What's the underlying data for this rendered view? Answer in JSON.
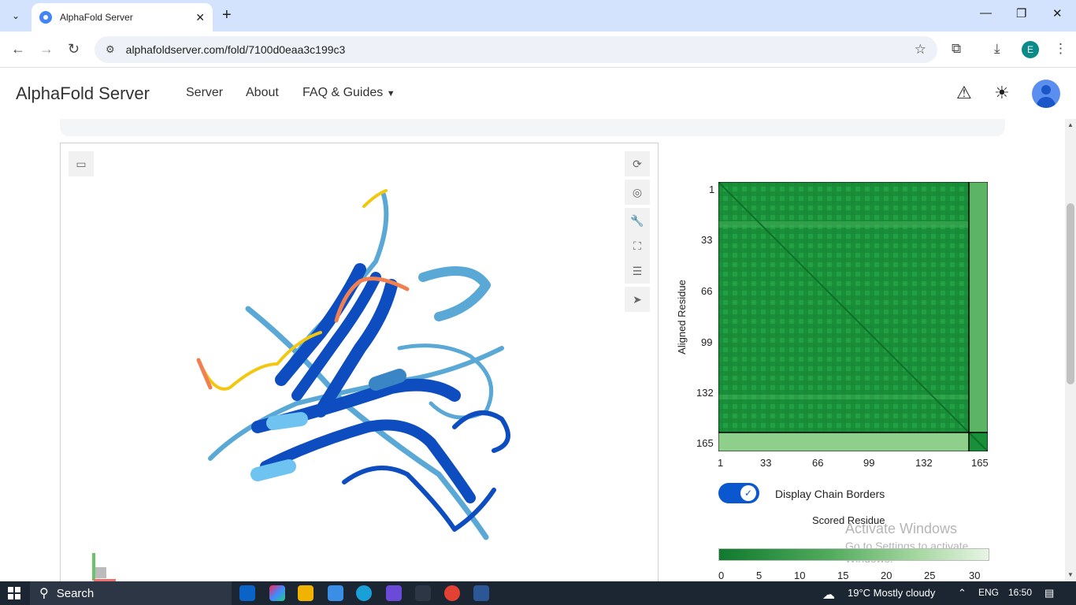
{
  "browser": {
    "tab_title": "AlphaFold Server",
    "url": "alphafoldserver.com/fold/7100d0eaa3c199c3",
    "profile_initial": "E"
  },
  "app": {
    "brand": "AlphaFold Server",
    "nav": [
      "Server",
      "About",
      "FAQ & Guides"
    ]
  },
  "pae": {
    "ylabel": "Aligned Residue",
    "xlabel": "Scored Residue",
    "y_ticks": [
      "1",
      "33",
      "66",
      "99",
      "132",
      "165"
    ],
    "x_ticks": [
      "1",
      "33",
      "66",
      "99",
      "132",
      "165"
    ],
    "toggle_label": "Display Chain Borders",
    "toggle_on": true,
    "colorbar_ticks": [
      "0",
      "5",
      "10",
      "15",
      "20",
      "25",
      "30"
    ],
    "colors": {
      "low": "#0f7a2e",
      "high": "#e8f5e4"
    }
  },
  "watermark": {
    "line1": "Activate Windows",
    "line2": "Go to Settings to activate Windows."
  },
  "taskbar": {
    "search": "Search",
    "weather": "19°C  Mostly cloudy",
    "lang": "ENG",
    "time": "16:50"
  }
}
